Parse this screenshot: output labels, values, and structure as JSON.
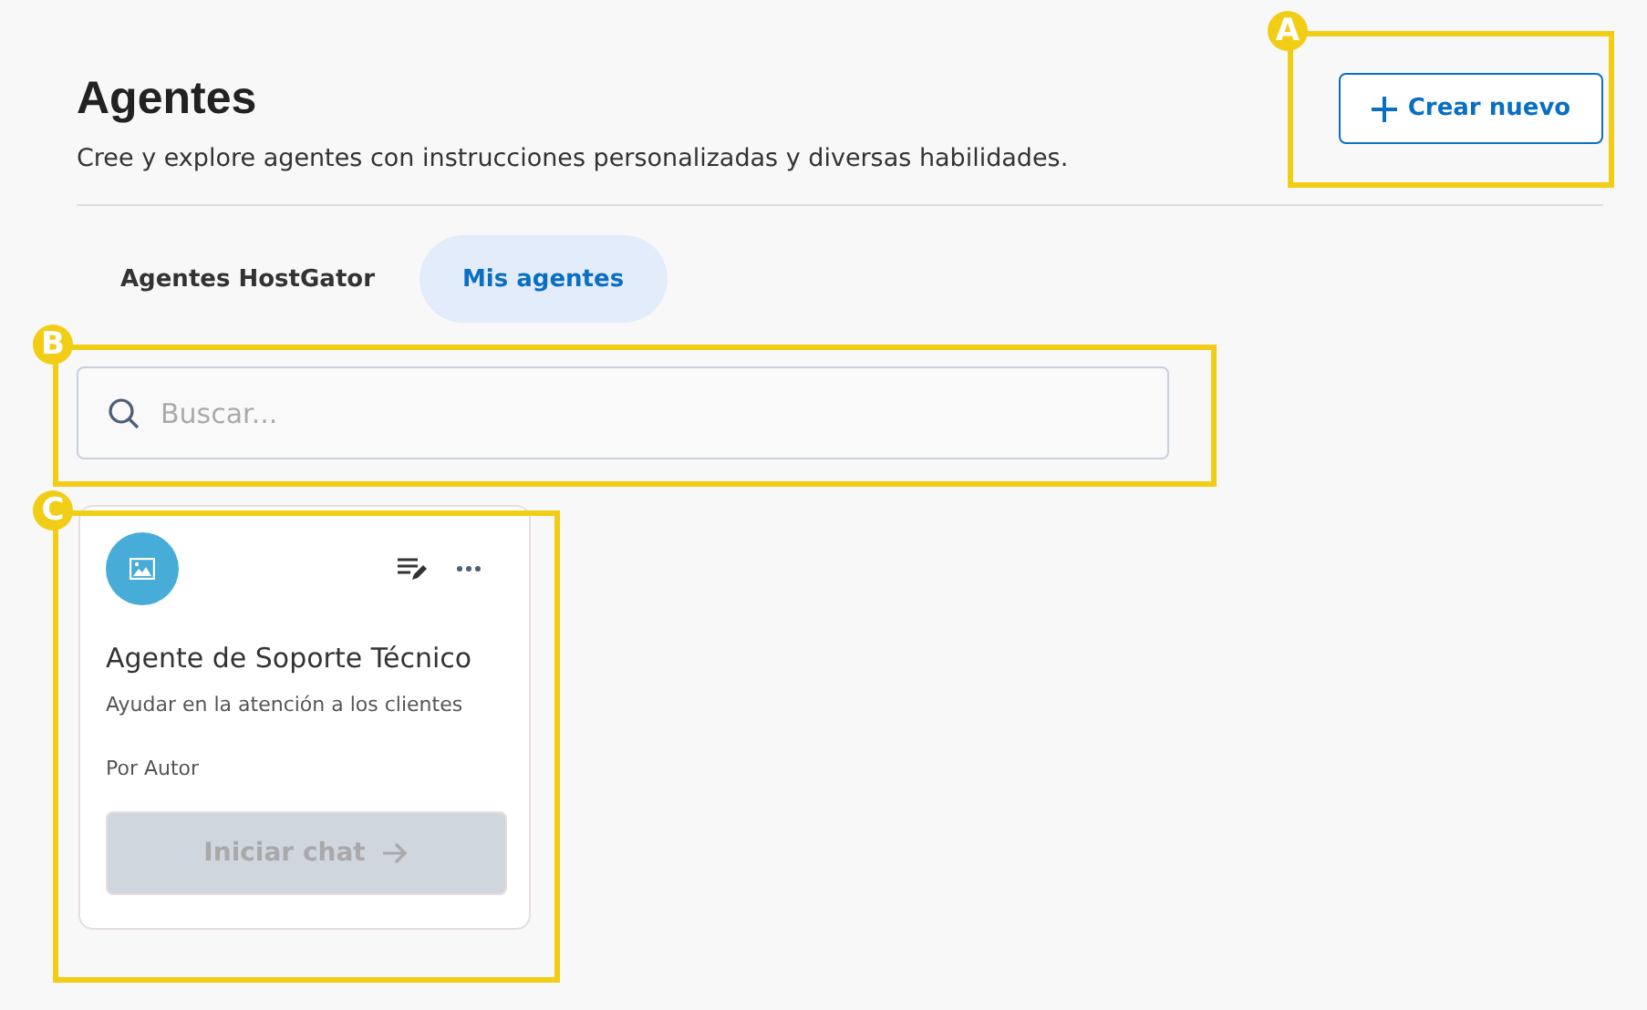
{
  "header": {
    "title": "Agentes",
    "subtitle": "Cree y explore agentes con instrucciones personalizadas y diversas habilidades.",
    "create_button": "Crear nuevo"
  },
  "tabs": [
    {
      "label": "Agentes HostGator",
      "selected": false
    },
    {
      "label": "Mis agentes",
      "selected": true
    }
  ],
  "search": {
    "placeholder": "Buscar..."
  },
  "agents": [
    {
      "name": "Agente de Soporte Técnico",
      "description": "Ayudar en la atención a los clientes",
      "author": "Por Autor",
      "action": "Iniciar chat",
      "disabled": true
    }
  ],
  "callouts": [
    {
      "label": "A"
    },
    {
      "label": "B"
    },
    {
      "label": "C"
    }
  ]
}
